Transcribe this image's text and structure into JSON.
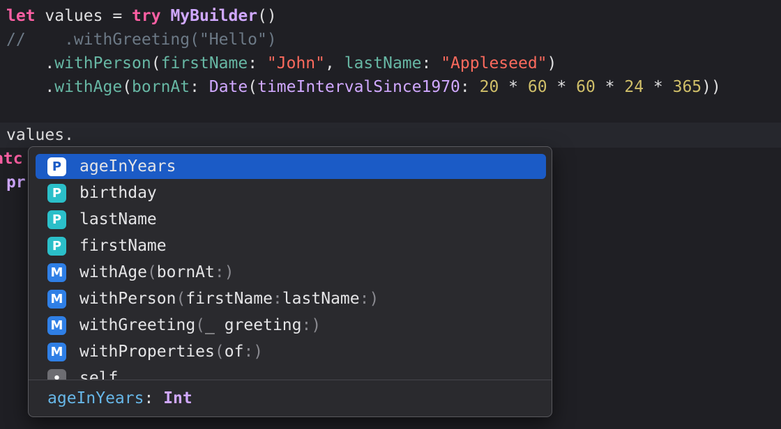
{
  "code": {
    "line1": {
      "kw_let": "let",
      "var": " values = ",
      "kw_try": "try",
      "space": " ",
      "type": "MyBuilder",
      "tail": "()"
    },
    "line2": {
      "comment": "//    .withGreeting(\"Hello\")"
    },
    "line3": {
      "indent": "    .",
      "method": "withPerson",
      "p1": "(",
      "label1": "firstName",
      "c1": ": ",
      "str1": "\"John\"",
      "sep": ", ",
      "label2": "lastName",
      "c2": ": ",
      "str2": "\"Appleseed\"",
      "p2": ")"
    },
    "line4": {
      "indent": "    .",
      "method": "withAge",
      "p1": "(",
      "label1": "bornAt",
      "c1": ": ",
      "type": "Date",
      "p2": "(",
      "label2": "timeIntervalSince1970",
      "c2": ": ",
      "n1": "20",
      "op1": " * ",
      "n2": "60",
      "op2": " * ",
      "n3": "60",
      "op3": " * ",
      "n4": "24",
      "op4": " * ",
      "n5": "365",
      "p3": "))"
    },
    "line6": {
      "text": "values."
    },
    "line7": {
      "text": "atc"
    },
    "line8": {
      "text": "pr"
    }
  },
  "completion": {
    "items": [
      {
        "kind": "P",
        "name": "ageInYears",
        "args": "",
        "selected": true
      },
      {
        "kind": "P",
        "name": "birthday",
        "args": ""
      },
      {
        "kind": "P",
        "name": "lastName",
        "args": ""
      },
      {
        "kind": "P",
        "name": "firstName",
        "args": ""
      },
      {
        "kind": "M",
        "name": "withAge",
        "args": "(bornAt:)"
      },
      {
        "kind": "M",
        "name": "withPerson",
        "args": "(firstName:lastName:)"
      },
      {
        "kind": "M",
        "name": "withGreeting",
        "args": "(_ greeting:)"
      },
      {
        "kind": "M",
        "name": "withProperties",
        "args": "(of:)"
      },
      {
        "kind": "•",
        "name": "self",
        "args": ""
      }
    ],
    "footer": {
      "name": "ageInYears",
      "colon": ": ",
      "type": "Int"
    }
  },
  "colors": {
    "background": "#1f1f24",
    "selection": "#1b5bc6",
    "property_badge": "#2bbfc9",
    "method_badge": "#2f7fe6",
    "keyword": "#fc5fa3",
    "string": "#fc6a5d",
    "number": "#d0bf69",
    "type": "#d0a8ff"
  }
}
